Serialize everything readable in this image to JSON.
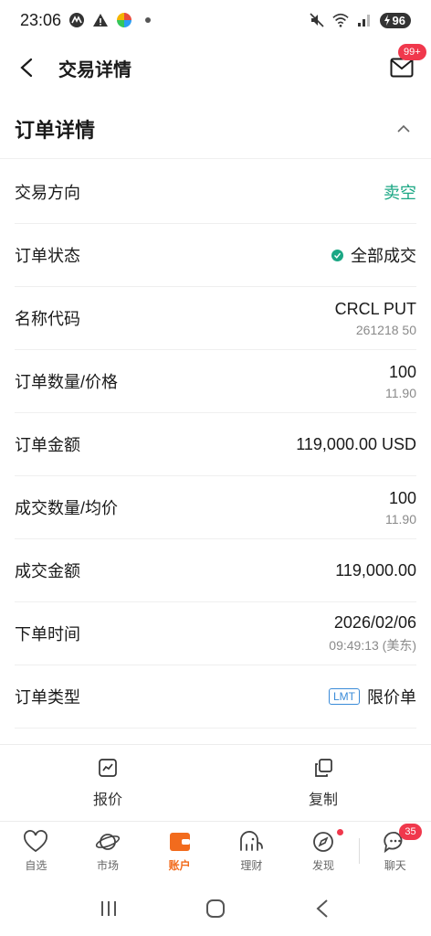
{
  "status_bar": {
    "time": "23:06",
    "battery": "96"
  },
  "header": {
    "title": "交易详情",
    "mail_badge": "99+"
  },
  "section": {
    "title": "订单详情"
  },
  "rows": {
    "direction": {
      "label": "交易方向",
      "value": "卖空"
    },
    "status": {
      "label": "订单状态",
      "value": "全部成交"
    },
    "name": {
      "label": "名称代码",
      "value": "CRCL PUT",
      "sub": "261218 50"
    },
    "qty_price": {
      "label": "订单数量/价格",
      "value": "100",
      "sub": "11.90"
    },
    "amount": {
      "label": "订单金额",
      "value": "119,000.00 USD"
    },
    "fill_qty_price": {
      "label": "成交数量/均价",
      "value": "100",
      "sub": "11.90"
    },
    "fill_amount": {
      "label": "成交金额",
      "value": "119,000.00"
    },
    "order_time": {
      "label": "下单时间",
      "value": "2026/02/06",
      "sub": "09:49:13 (美东)"
    },
    "order_type": {
      "label": "订单类型",
      "tag": "LMT",
      "value": "限价单"
    }
  },
  "actions": {
    "quote": "报价",
    "copy": "复制"
  },
  "tabs": [
    {
      "label": "自选",
      "icon": "heart-icon"
    },
    {
      "label": "市场",
      "icon": "planet-icon"
    },
    {
      "label": "账户",
      "icon": "wallet-icon"
    },
    {
      "label": "理财",
      "icon": "elephant-icon"
    },
    {
      "label": "发现",
      "icon": "compass-icon"
    },
    {
      "label": "聊天",
      "icon": "chat-icon",
      "badge": "35"
    }
  ],
  "colors": {
    "accent": "#f26b1d",
    "green": "#1ba784",
    "badge_red": "#f0384c",
    "tag_blue": "#3a8bd8"
  }
}
